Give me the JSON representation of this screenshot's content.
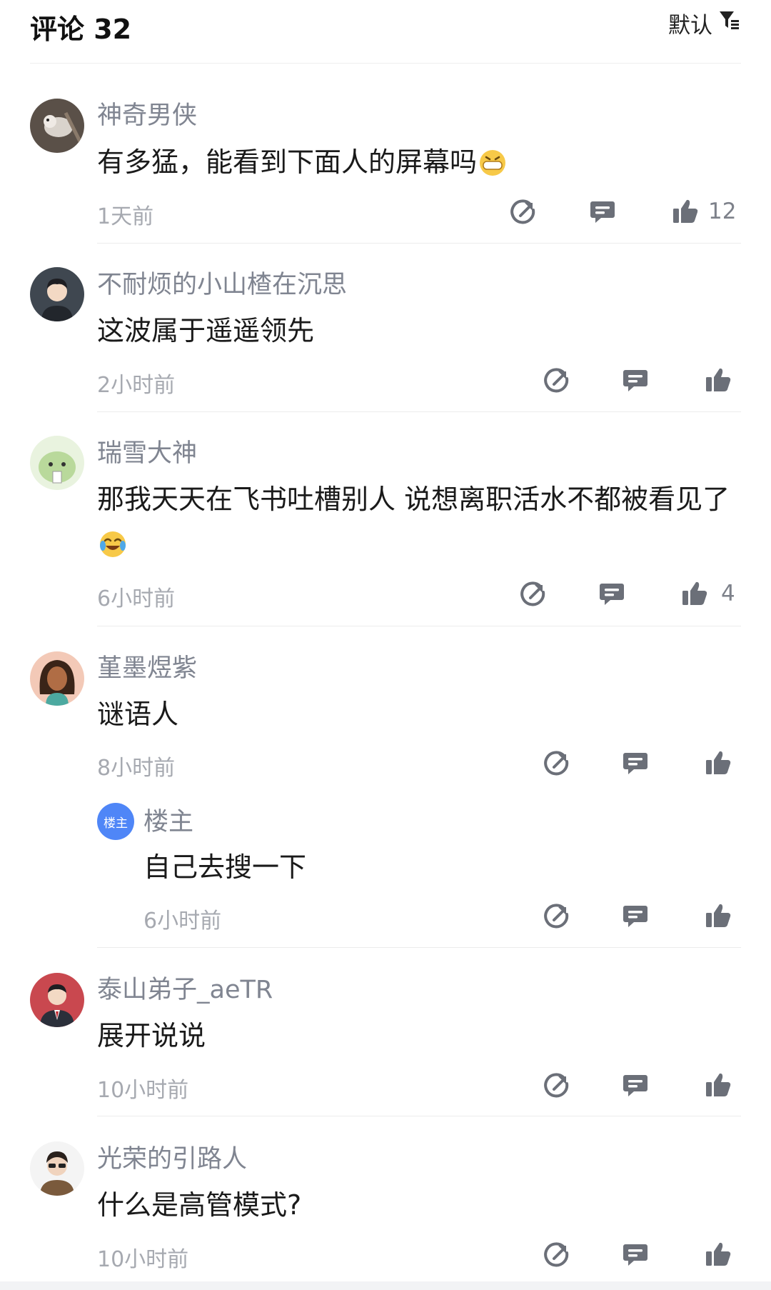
{
  "header": {
    "title": "评论 32",
    "sort_label": "默认"
  },
  "comments": [
    {
      "username": "神奇男侠",
      "text": "有多猛，能看到下面人的屏幕吗",
      "emoji": "grinning-face-emoji",
      "time": "1天前",
      "likes": "12"
    },
    {
      "username": "不耐烦的小山楂在沉思",
      "text": "这波属于遥遥领先",
      "time": "2小时前",
      "likes": ""
    },
    {
      "username": "瑞雪大神",
      "text": "那我天天在飞书吐槽别人 说想离职活水不都被看见了",
      "emoji": "tears-of-joy-emoji",
      "time": "6小时前",
      "likes": "4"
    },
    {
      "username": "堇墨煜紫",
      "text": "谜语人",
      "time": "8小时前",
      "likes": "",
      "reply": {
        "badge": "楼主",
        "username": "楼主",
        "text": "自己去搜一下",
        "time": "6小时前"
      }
    },
    {
      "username": "泰山弟子_aeTR",
      "text": "展开说说",
      "time": "10小时前",
      "likes": ""
    },
    {
      "username": "光荣的引路人",
      "text": "什么是高管模式?",
      "time": "10小时前",
      "likes": ""
    }
  ],
  "colors": {
    "icon": "#6b6f78",
    "username": "#808591",
    "time": "#a6a9b0",
    "badge": "#4f86f7"
  },
  "icons": [
    "share-icon",
    "reply-icon",
    "like-icon",
    "filter-icon"
  ]
}
